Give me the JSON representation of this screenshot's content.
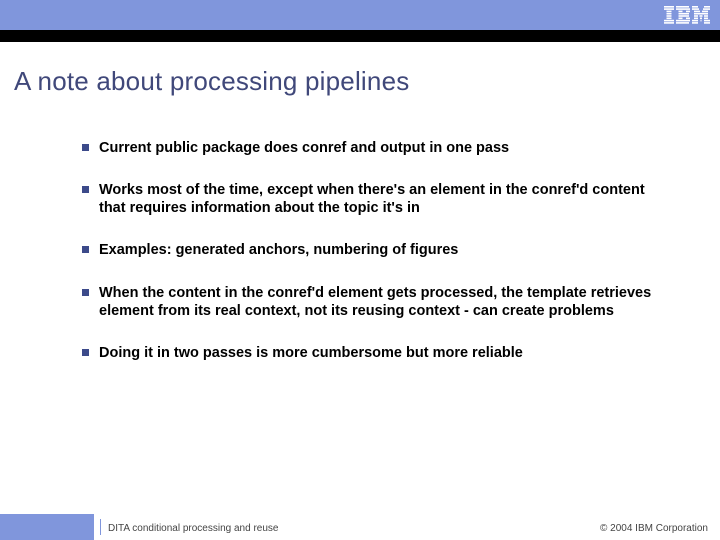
{
  "logo_name": "ibm-logo",
  "title": "A note about processing pipelines",
  "bullets": [
    "Current public package does conref and output in one pass",
    "Works most of the time, except when there's an element in the conref'd content that requires information about the topic it's in",
    "Examples: generated anchors, numbering of figures",
    "When the content in the conref'd element gets processed, the template retrieves element from its real context, not its reusing context - can create problems",
    "Doing it in two passes is more cumbersome but more reliable"
  ],
  "footer": {
    "left": "DITA conditional processing and reuse",
    "right": "© 2004 IBM Corporation"
  }
}
